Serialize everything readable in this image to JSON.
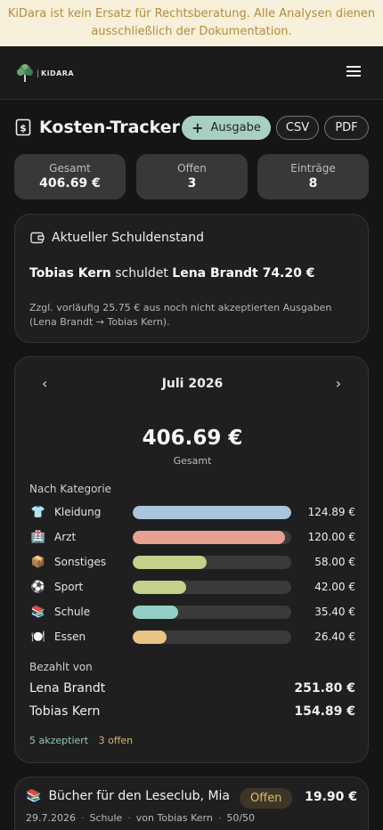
{
  "banner": {
    "text": "KiDara ist kein Ersatz für Rechtsberatung. Alle Analysen dienen ausschließlich der Dokumentation."
  },
  "header": {
    "logo_text": "KiDARA",
    "menu_icon": "hamburger-icon"
  },
  "page": {
    "title": "Kosten-Tracker",
    "title_icon": "dollar-document-icon",
    "add_label": "Ausgabe",
    "csv_label": "CSV",
    "pdf_label": "PDF"
  },
  "stats": [
    {
      "label": "Gesamt",
      "value": "406.69 €"
    },
    {
      "label": "Offen",
      "value": "3"
    },
    {
      "label": "Einträge",
      "value": "8"
    }
  ],
  "debt": {
    "heading": "Aktueller Schuldenstand",
    "debtor": "Tobias Kern",
    "verb": "schuldet",
    "creditor_amount": "Lena Brandt 74.20 €",
    "note": "Zzgl. vorläufig 25.75 € aus noch nicht akzeptierten Ausgaben (Lena Brandt → Tobias Kern)."
  },
  "month": {
    "prev": "‹",
    "next": "›",
    "title": "Juli 2026",
    "total": "406.69 €",
    "total_label": "Gesamt",
    "category_heading": "Nach Kategorie",
    "categories": [
      {
        "emoji": "👕",
        "name": "Kleidung",
        "amount": "124.89 €",
        "fraction": 1.0,
        "color": "#a9c4dc"
      },
      {
        "emoji": "🏥",
        "name": "Arzt",
        "amount": "120.00 €",
        "fraction": 0.96,
        "color": "#e6a193"
      },
      {
        "emoji": "📦",
        "name": "Sonstiges",
        "amount": "58.00 €",
        "fraction": 0.465,
        "color": "#c3d18a"
      },
      {
        "emoji": "⚽",
        "name": "Sport",
        "amount": "42.00 €",
        "fraction": 0.337,
        "color": "#c3d18a"
      },
      {
        "emoji": "📚",
        "name": "Schule",
        "amount": "35.40 €",
        "fraction": 0.284,
        "color": "#93cfc6"
      },
      {
        "emoji": "🍽️",
        "name": "Essen",
        "amount": "26.40 €",
        "fraction": 0.212,
        "color": "#e8c384"
      }
    ],
    "paid_heading": "Bezahlt von",
    "payers": [
      {
        "name": "Lena Brandt",
        "amount": "251.80 €"
      },
      {
        "name": "Tobias Kern",
        "amount": "154.89 €"
      }
    ],
    "accepted": "5 akzeptiert",
    "open": "3 offen"
  },
  "expense": {
    "emoji": "📚",
    "title": "Bücher für den Leseclub, Mia",
    "badge": "Offen",
    "amount": "19.90 €",
    "date": "29.7.2026",
    "category": "Schule",
    "payer": "von Tobias Kern",
    "split": "50/50"
  }
}
